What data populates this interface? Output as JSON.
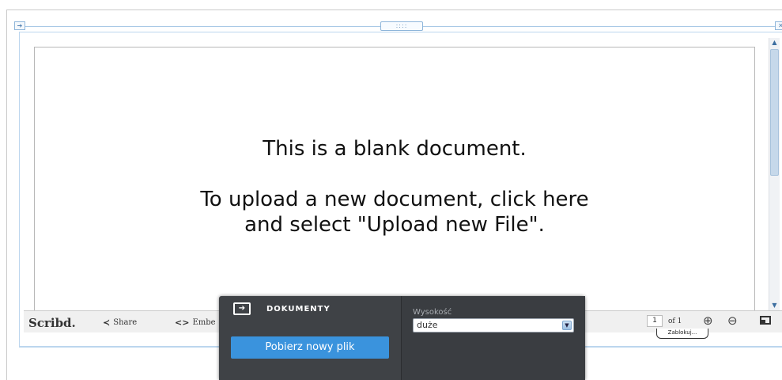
{
  "frame": {
    "left_handle_icon": "arrow-right-icon",
    "right_handle_icon": "close-icon",
    "center_handle_grip": "::::"
  },
  "document": {
    "title": "This is a blank document.",
    "message": "To upload a new document, click here\nand select \"Upload new File\"."
  },
  "toolbar": {
    "logo": "Scribd.",
    "share_label": "Share",
    "embed_label": "Embe",
    "page_current": "1",
    "page_total": "of 1",
    "tooltip": "Zablokuj..."
  },
  "panel": {
    "header_label": "DOKUMENTY",
    "upload_button_label": "Pobierz nowy plik",
    "height_label": "Wysokość",
    "height_value": "duże"
  },
  "colors": {
    "panel_bg": "#3f4246",
    "button_blue": "#3a93dd",
    "guide_blue": "#a9c9e6"
  }
}
